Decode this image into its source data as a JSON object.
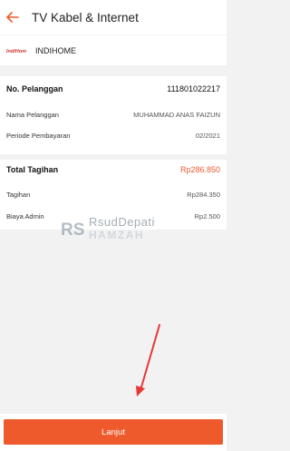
{
  "header": {
    "title": "TV Kabel & Internet",
    "back_icon": "arrow-left-icon",
    "accent": "#ee5a2c"
  },
  "provider": {
    "name": "INDIHOME",
    "logo_text": "IndiHome",
    "logo_color": "#d4312b"
  },
  "customer": {
    "id_label": "No. Pelanggan",
    "id_value": "111801022217",
    "name_label": "Nama Pelanggan",
    "name_value": "MUHAMMAD ANAS FAIZUN",
    "period_label": "Periode Pembayaran",
    "period_value": "02/2021"
  },
  "bill": {
    "total_label": "Total Tagihan",
    "total_value": "Rp286.850",
    "tagihan_label": "Tagihan",
    "tagihan_value": "Rp284.350",
    "admin_label": "Biaya Admin",
    "admin_value": "Rp2.500"
  },
  "watermark": {
    "line1": "RsudDepati",
    "line2": "HAMZAH"
  },
  "footer": {
    "button_label": "Lanjut"
  },
  "annotation": {
    "arrow_color": "#e53935"
  }
}
